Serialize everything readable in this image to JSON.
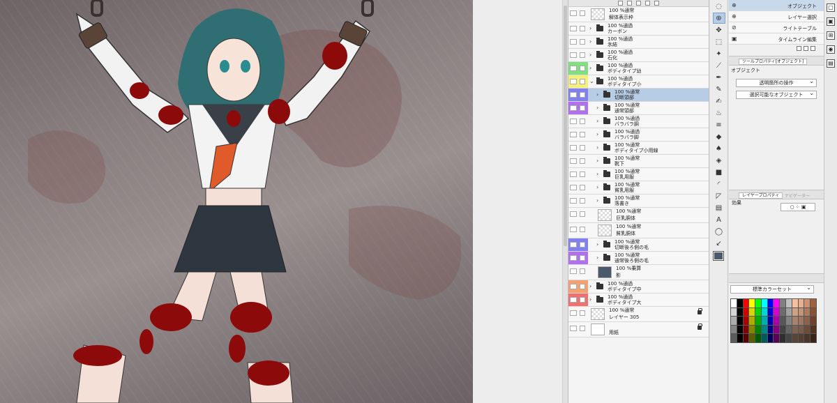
{
  "colors": {
    "selected_row": "#b7cde6",
    "blood": "#8c0a0a"
  },
  "layers": [
    {
      "mode": "100 %通常",
      "name": "解体表示枠",
      "type": "raster",
      "label_color": ""
    },
    {
      "mode": "100 %通過",
      "name": "カーボン",
      "type": "folder",
      "label_color": ""
    },
    {
      "mode": "100 %通過",
      "name": "氷結",
      "type": "folder",
      "label_color": ""
    },
    {
      "mode": "100 %通過",
      "name": "石化",
      "type": "folder",
      "label_color": ""
    },
    {
      "mode": "100 %通過",
      "name": "ボディタイプ幼",
      "type": "folder",
      "label_color": "#7fe07f"
    },
    {
      "mode": "100 %通過",
      "name": "ボディタイプ小",
      "type": "folder",
      "label_color": "#f4f07a",
      "expanded": true
    },
    {
      "mode": "100 %通常",
      "name": "切断頭部",
      "type": "folder",
      "label_color": "#8080f0",
      "selected": true
    },
    {
      "mode": "100 %通常",
      "name": "通常頭部",
      "type": "folder",
      "label_color": "#b070f0"
    },
    {
      "mode": "100 %通過",
      "name": "バラバラ胴",
      "type": "folder",
      "label_color": ""
    },
    {
      "mode": "100 %通過",
      "name": "バラバラ脚",
      "type": "folder",
      "label_color": ""
    },
    {
      "mode": "100 %通常",
      "name": "ボディタイプ小用線",
      "type": "folder",
      "label_color": ""
    },
    {
      "mode": "100 %通常",
      "name": "靴下",
      "type": "folder",
      "label_color": ""
    },
    {
      "mode": "100 %通常",
      "name": "巨乳用服",
      "type": "folder",
      "label_color": ""
    },
    {
      "mode": "100 %通常",
      "name": "貧乳用服",
      "type": "folder",
      "label_color": ""
    },
    {
      "mode": "100 %通常",
      "name": "落書き",
      "type": "folder",
      "label_color": ""
    },
    {
      "mode": "100 %通常",
      "name": "巨乳胴体",
      "type": "raster",
      "label_color": ""
    },
    {
      "mode": "100 %通常",
      "name": "貧乳胴体",
      "type": "raster",
      "label_color": ""
    },
    {
      "mode": "100 %通常",
      "name": "切断後ろ側の毛",
      "type": "folder",
      "label_color": "#8080f0"
    },
    {
      "mode": "100 %通常",
      "name": "通常後ろ側の毛",
      "type": "folder",
      "label_color": "#b070f0"
    },
    {
      "mode": "100 %乗算",
      "name": "影",
      "type": "mask",
      "label_color": ""
    },
    {
      "mode": "100 %通過",
      "name": "ボディタイプ中",
      "type": "folder",
      "label_color": "#f4a070"
    },
    {
      "mode": "100 %通過",
      "name": "ボディタイプ大",
      "type": "folder",
      "label_color": "#f07070"
    },
    {
      "mode": "100 %通常",
      "name": "レイヤー 305",
      "type": "raster",
      "label_color": "",
      "locked": true
    },
    {
      "mode": "",
      "name": "用紙",
      "type": "paper",
      "label_color": "",
      "locked": true
    }
  ],
  "subtool": [
    {
      "label": "オブジェクト",
      "icon": "⊕",
      "active": true
    },
    {
      "label": "レイヤー選択",
      "icon": "⊕",
      "active": false
    },
    {
      "label": "ライトテーブル",
      "icon": "⊘",
      "active": false
    },
    {
      "label": "タイムライン編集",
      "icon": "▣",
      "active": false
    }
  ],
  "tool_property": {
    "tab": "ツールプロパティ[オブジェクト]",
    "title": "オブジェクト",
    "select1": "透明箇所の操作",
    "select2": "選択可能なオブジェクト"
  },
  "layer_property": {
    "tab": "レイヤープロパティ",
    "tab2": "ナビゲーター",
    "effect_label": "効果"
  },
  "color_set": {
    "select": "標準カラーセット"
  }
}
